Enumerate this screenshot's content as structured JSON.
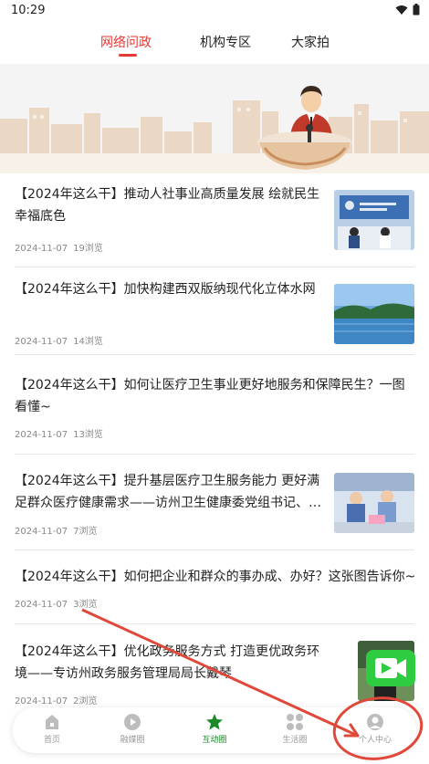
{
  "status": {
    "time": "10:29"
  },
  "tabs": [
    {
      "label": "网络问政",
      "active": true
    },
    {
      "label": "机构专区",
      "active": false
    },
    {
      "label": "大家拍",
      "active": false
    }
  ],
  "colors": {
    "accent": "#e53935",
    "nav_active": "#1a8a2a",
    "annotation": "#e0483a"
  },
  "articles": [
    {
      "title": "【2024年这么干】推动人社事业高质量发展 绘就民生幸福底色",
      "date": "2024-11-07",
      "views": "19浏览",
      "has_thumb": true
    },
    {
      "title": "【2024年这么干】加快构建西双版纳现代化立体水网",
      "date": "2024-11-07",
      "views": "14浏览",
      "has_thumb": true
    },
    {
      "title": "【2024年这么干】如何让医疗卫生事业更好地服务和保障民生？一图看懂~",
      "date": "2024-11-07",
      "views": "13浏览",
      "has_thumb": false
    },
    {
      "title": "【2024年这么干】提升基层医疗卫生服务能力 更好满足群众医疗健康需求——访州卫生健康委党组书记、…",
      "date": "2024-11-07",
      "views": "7浏览",
      "has_thumb": true
    },
    {
      "title": "【2024年这么干】如何把企业和群众的事办成、办好？这张图告诉你~",
      "date": "2024-11-07",
      "views": "3浏览",
      "has_thumb": false
    },
    {
      "title": "【2024年这么干】优化政务服务方式 打造更优政务环境——专访州政务服务管理局局长戴琴",
      "date": "2024-11-07",
      "views": "2浏览",
      "has_thumb": true
    }
  ],
  "bottom_nav": [
    {
      "label": "首页",
      "icon": "home-icon",
      "active": false
    },
    {
      "label": "融媒圈",
      "icon": "play-icon",
      "active": false
    },
    {
      "label": "互动圈",
      "icon": "star-icon",
      "active": true
    },
    {
      "label": "生活圈",
      "icon": "grid-icon",
      "active": false
    },
    {
      "label": "个人中心",
      "icon": "person-icon",
      "active": false
    }
  ]
}
